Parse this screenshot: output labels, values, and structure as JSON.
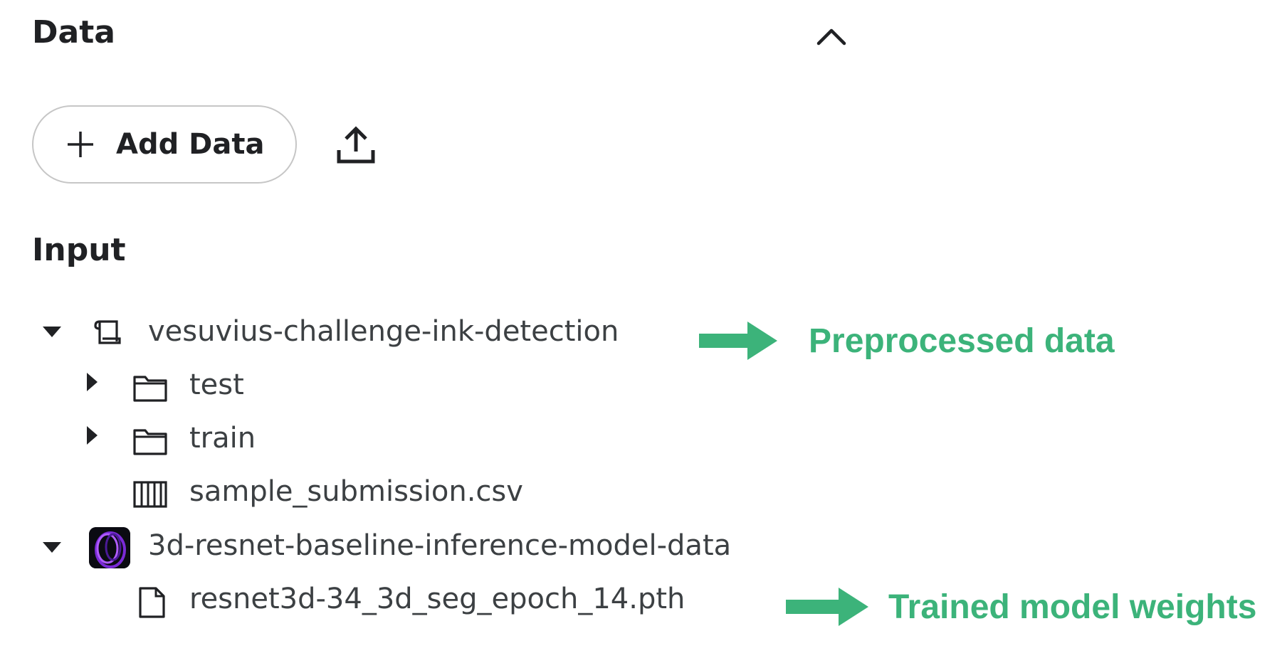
{
  "panel": {
    "title": "Data",
    "collapse_icon": "chevron-up-icon",
    "add_data_label": "Add Data",
    "upload_icon": "upload-icon"
  },
  "input": {
    "title": "Input",
    "tree": [
      {
        "label": "vesuvius-challenge-ink-detection",
        "icon": "scroll-icon",
        "expanded": true,
        "depth": 0
      },
      {
        "label": "test",
        "icon": "folder-icon",
        "expanded": false,
        "depth": 1
      },
      {
        "label": "train",
        "icon": "folder-icon",
        "expanded": false,
        "depth": 1
      },
      {
        "label": "sample_submission.csv",
        "icon": "table-columns-icon",
        "depth": 1
      },
      {
        "label": "3d-resnet-baseline-inference-model-data",
        "icon": "dataset-thumbnail",
        "expanded": true,
        "depth": 0
      },
      {
        "label": "resnet3d-34_3d_seg_epoch_14.pth",
        "icon": "file-icon",
        "depth": 1
      }
    ]
  },
  "annotations": [
    {
      "text": "Preprocessed data",
      "color": "#3cb37a"
    },
    {
      "text": "Trained model weights",
      "color": "#3cb37a"
    }
  ]
}
